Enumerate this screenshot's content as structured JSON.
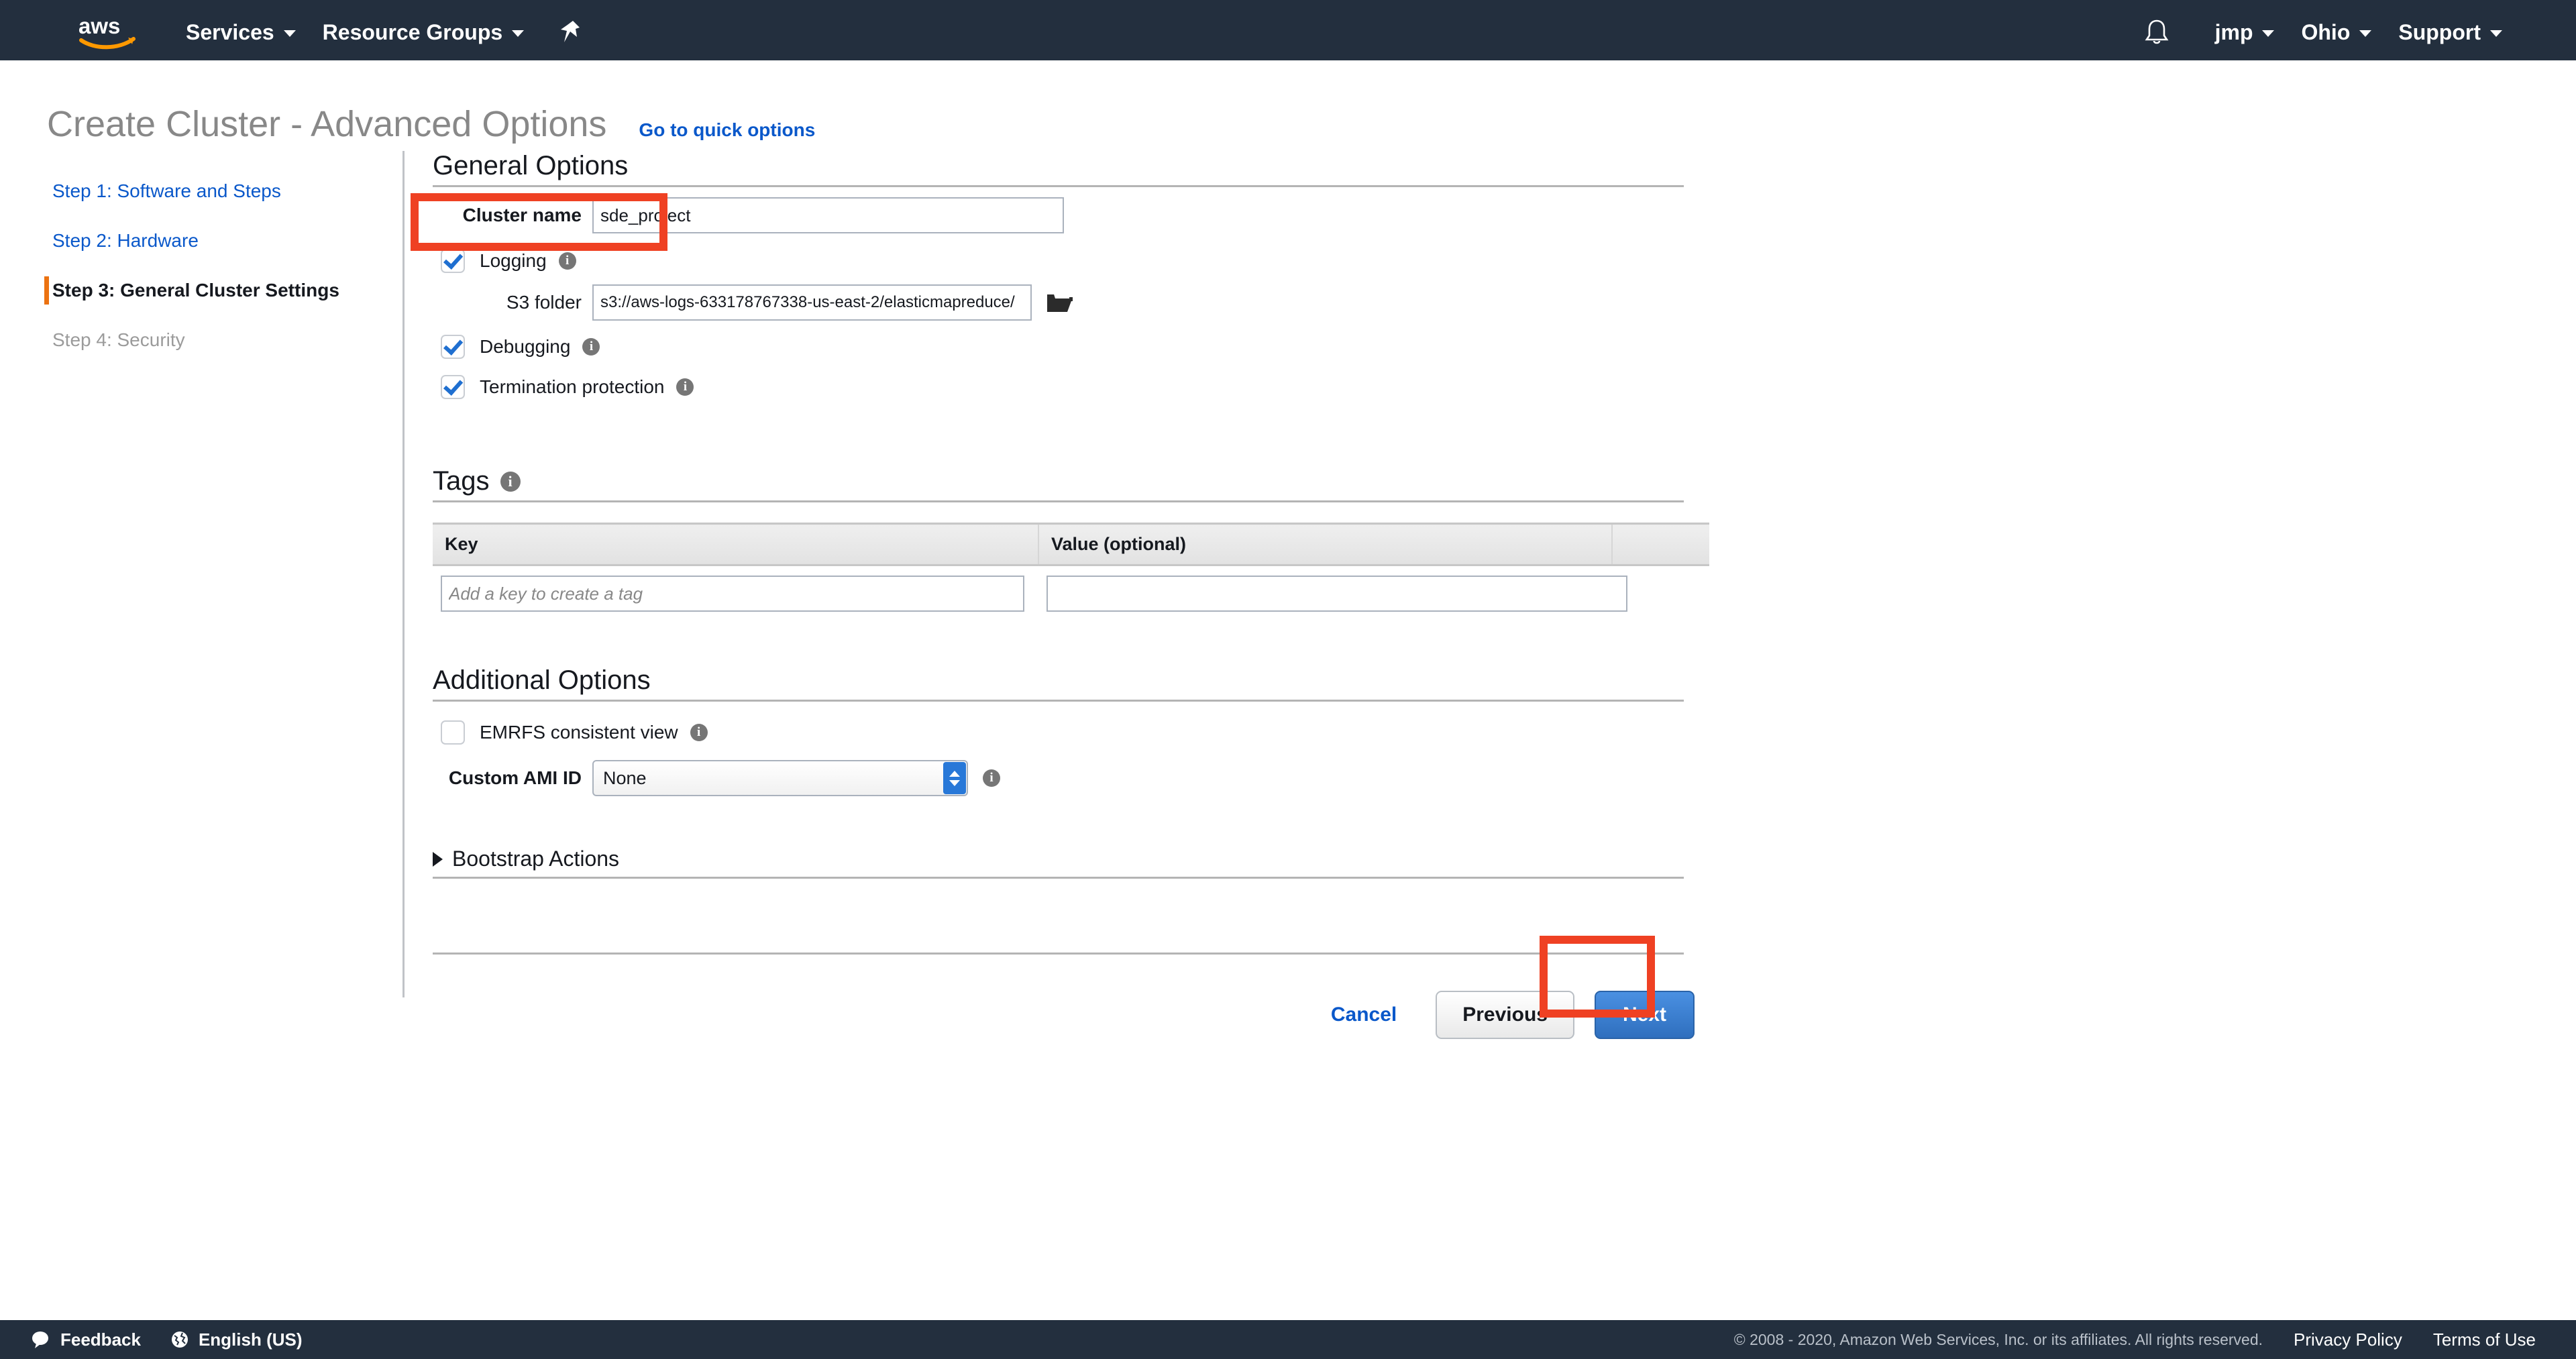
{
  "navbar": {
    "logo_alt": "aws",
    "items": [
      {
        "label": "Services",
        "has_caret": true
      },
      {
        "label": "Resource Groups",
        "has_caret": true
      }
    ],
    "pin_icon": "pin-icon",
    "bell_icon": "bell-icon",
    "account": "jmp",
    "region": "Ohio",
    "support": "Support"
  },
  "header": {
    "title": "Create Cluster - Advanced Options",
    "quick_options_link": "Go to quick options"
  },
  "sidebar": {
    "steps": [
      {
        "label": "Step 1: Software and Steps",
        "state": "link"
      },
      {
        "label": "Step 2: Hardware",
        "state": "link"
      },
      {
        "label": "Step 3: General Cluster Settings",
        "state": "active"
      },
      {
        "label": "Step 4: Security",
        "state": "disabled"
      }
    ]
  },
  "general_options": {
    "title": "General Options",
    "cluster_name": {
      "label": "Cluster name",
      "value": "sde_project"
    },
    "logging": {
      "label": "Logging",
      "checked": true,
      "info": "info-icon"
    },
    "s3_folder": {
      "label": "S3 folder",
      "value": "s3://aws-logs-633178767338-us-east-2/elasticmapreduce/",
      "browse_icon": "folder-icon"
    },
    "debugging": {
      "label": "Debugging",
      "checked": true,
      "info": "info-icon"
    },
    "termination_protection": {
      "label": "Termination protection",
      "checked": true,
      "info": "info-icon"
    }
  },
  "tags": {
    "title": "Tags",
    "info": "info-icon",
    "columns": [
      "Key",
      "Value (optional)"
    ],
    "rows": [
      {
        "key_placeholder": "Add a key to create a tag",
        "key_value": "",
        "value_value": ""
      }
    ]
  },
  "additional_options": {
    "title": "Additional Options",
    "emrfs_consistent_view": {
      "label": "EMRFS consistent view",
      "checked": false,
      "info": "info-icon"
    },
    "custom_ami_id": {
      "label": "Custom AMI ID",
      "selected": "None",
      "info": "info-icon"
    },
    "bootstrap_actions": {
      "label": "Bootstrap Actions",
      "expanded": false
    }
  },
  "actions": {
    "cancel": "Cancel",
    "previous": "Previous",
    "next": "Next"
  },
  "footer": {
    "feedback": "Feedback",
    "language": "English (US)",
    "copyright": "© 2008 - 2020, Amazon Web Services, Inc. or its affiliates. All rights reserved.",
    "privacy_policy": "Privacy Policy",
    "terms_of_use": "Terms of Use"
  },
  "annotations": {
    "highlight_color": "#ef4123",
    "boxes": [
      "cluster-name-field",
      "next-button"
    ]
  }
}
